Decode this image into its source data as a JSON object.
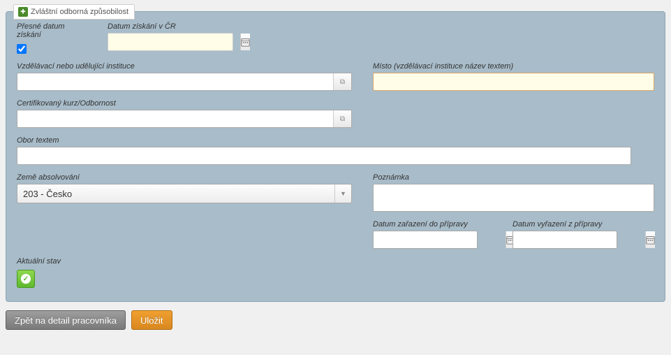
{
  "legend": "Zvláštní odborná způsobilost",
  "labels": {
    "presne_datum": "Přesné datum získání",
    "datum_ziskani": "Datum získání v ČR",
    "instituce": "Vzdělávací nebo udělující instituce",
    "misto": "Místo (vzdělávací instituce název textem)",
    "kurz": "Certifikovaný kurz/Odbornost",
    "obor": "Obor textem",
    "zeme": "Země absolvování",
    "poznamka": "Poznámka",
    "datum_zarazeni": "Datum zařazení do přípravy",
    "datum_vyrazeni": "Datum vyřazení z přípravy",
    "aktualni_stav": "Aktuální stav"
  },
  "values": {
    "presne_datum_checked": true,
    "datum_ziskani": "",
    "instituce": "",
    "misto": "",
    "kurz": "",
    "obor": "",
    "zeme": "203 - Česko",
    "poznamka": "",
    "datum_zarazeni": "",
    "datum_vyrazeni": ""
  },
  "buttons": {
    "back": "Zpět na detail pracovníka",
    "save": "Uložit"
  }
}
